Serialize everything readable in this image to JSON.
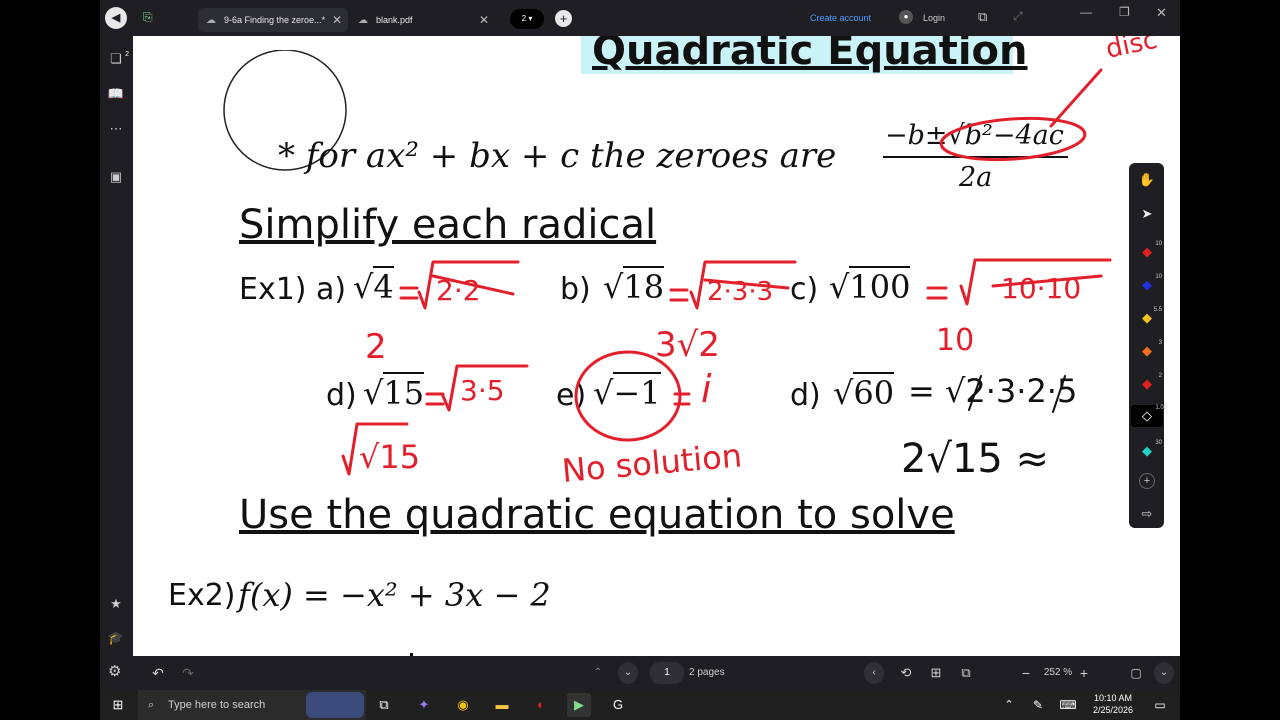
{
  "tabs": [
    {
      "label": "9-6a Finding the zeroe...*",
      "active": true
    },
    {
      "label": "blank.pdf",
      "active": false
    }
  ],
  "tab_counter": "2",
  "header": {
    "create_account": "Create account",
    "login": "Login"
  },
  "rail": {
    "badge_count": "2"
  },
  "doc": {
    "title": "Quadratic Equation",
    "formula_prefix": "* for ax² + bx + c  the zeroes are",
    "formula_numerator": "−b±√b²−4ac",
    "formula_denominator": "2a",
    "heading1": "Simplify each radical",
    "ex1_label": "Ex1)",
    "items": [
      {
        "label": "a)",
        "radicand": "4"
      },
      {
        "label": "b)",
        "radicand": "18"
      },
      {
        "label": "c)",
        "radicand": "100"
      },
      {
        "label": "d)",
        "radicand": "15"
      },
      {
        "label": "e)",
        "radicand": "−1"
      },
      {
        "label": "d)",
        "radicand": "60"
      }
    ],
    "heading2": "Use the quadratic equation to solve",
    "ex2_label": "Ex2)",
    "ex2_equation": "f(x) = −x² + 3x − 2"
  },
  "annotations": {
    "disc": "disc",
    "a_work": "2·2",
    "a_ans": "2",
    "b_work": "2·3·3",
    "b_ans": "3√2",
    "c_work": "10·10",
    "c_ans": "10",
    "d_work": "3·5",
    "d_ans": "√15",
    "e_work": "i",
    "e_ans": "No solution",
    "f_work": "= √2·3·2·5",
    "f_ans": "2√15 ≈"
  },
  "tools": {
    "sizes": [
      "10",
      "10",
      "5.5",
      "3",
      "2",
      "1.08",
      "30"
    ],
    "colors": [
      "#e02020",
      "#2030e0",
      "#f0c020",
      "#f07020",
      "#e02020",
      "#ffffff",
      "#20d0c0"
    ]
  },
  "bottom": {
    "page_number": "1",
    "page_total": "2 pages",
    "zoom": "252 %"
  },
  "taskbar": {
    "search_placeholder": "Type here to search",
    "time": "10:10 AM",
    "date": "2/25/2026"
  }
}
